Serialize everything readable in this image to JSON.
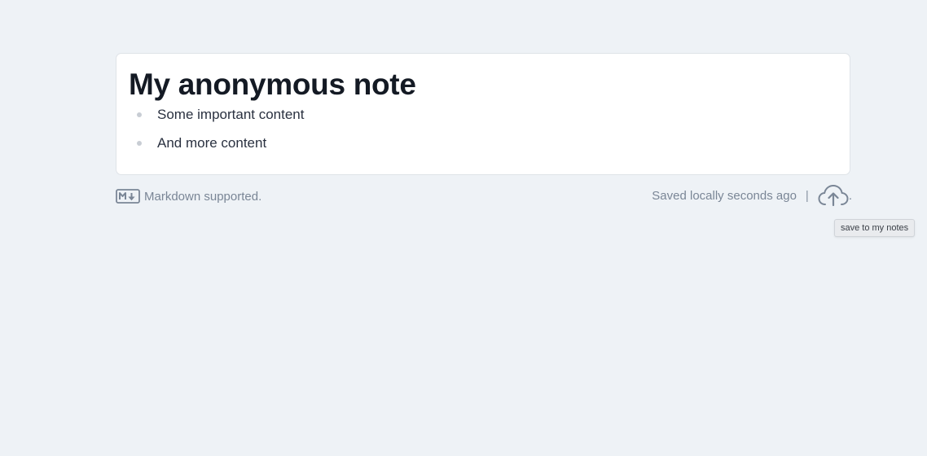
{
  "note": {
    "title": "My anonymous note",
    "items": [
      "Some important content",
      "And more content"
    ]
  },
  "footer": {
    "markdown_icon": "markdown-icon",
    "markdown_label": "Markdown supported.",
    "status": "Saved locally seconds ago",
    "separator": "|",
    "save_icon": "cloud-upload-icon",
    "trailing_dot": "."
  },
  "tooltip": {
    "text": "save to my notes"
  },
  "colors": {
    "background": "#eef2f6",
    "card": "#ffffff",
    "title": "#141a24",
    "muted": "#7a8696"
  }
}
